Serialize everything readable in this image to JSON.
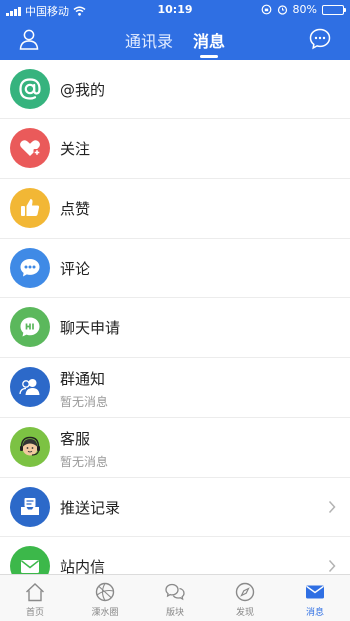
{
  "status_bar": {
    "carrier": "中国移动",
    "time": "10:19",
    "battery": "80%",
    "battery_fraction": 0.8
  },
  "header": {
    "tabs": [
      {
        "label": "通讯录",
        "active": false
      },
      {
        "label": "消息",
        "active": true
      }
    ]
  },
  "colors": {
    "brand_blue": "#2f6fe3",
    "green": "#3cb878",
    "red": "#e85a5a",
    "yellow": "#f2b735",
    "blue": "#3f8ae6",
    "hi_green": "#5bb85c",
    "dark_blue": "#2c69c9"
  },
  "messages": [
    {
      "title": "@我的",
      "subtitle": "",
      "icon": "at-icon",
      "color": "#36b37e"
    },
    {
      "title": "关注",
      "subtitle": "",
      "icon": "heart-plus-icon",
      "color": "#ea5a5a"
    },
    {
      "title": "点赞",
      "subtitle": "",
      "icon": "thumbs-up-icon",
      "color": "#f2b735"
    },
    {
      "title": "评论",
      "subtitle": "",
      "icon": "comment-icon",
      "color": "#3f8ae6"
    },
    {
      "title": "聊天申请",
      "subtitle": "",
      "icon": "hi-icon",
      "color": "#5bb85c"
    },
    {
      "title": "群通知",
      "subtitle": "暂无消息",
      "icon": "group-icon",
      "color": "#2c69c9"
    },
    {
      "title": "客服",
      "subtitle": "暂无消息",
      "icon": "customer-service-icon",
      "color": "#7cc243"
    },
    {
      "title": "推送记录",
      "subtitle": "",
      "icon": "inbox-icon",
      "color": "#2c69c9"
    },
    {
      "title": "站内信",
      "subtitle": "",
      "icon": "envelope-icon",
      "color": "#3cb84a"
    }
  ],
  "tabbar": [
    {
      "label": "首页",
      "icon": "home-icon",
      "active": false
    },
    {
      "label": "溧水圈",
      "icon": "circle-icon",
      "active": false
    },
    {
      "label": "版块",
      "icon": "chat-bubbles-icon",
      "active": false
    },
    {
      "label": "发现",
      "icon": "compass-icon",
      "active": false
    },
    {
      "label": "消息",
      "icon": "mail-icon",
      "active": true
    }
  ]
}
